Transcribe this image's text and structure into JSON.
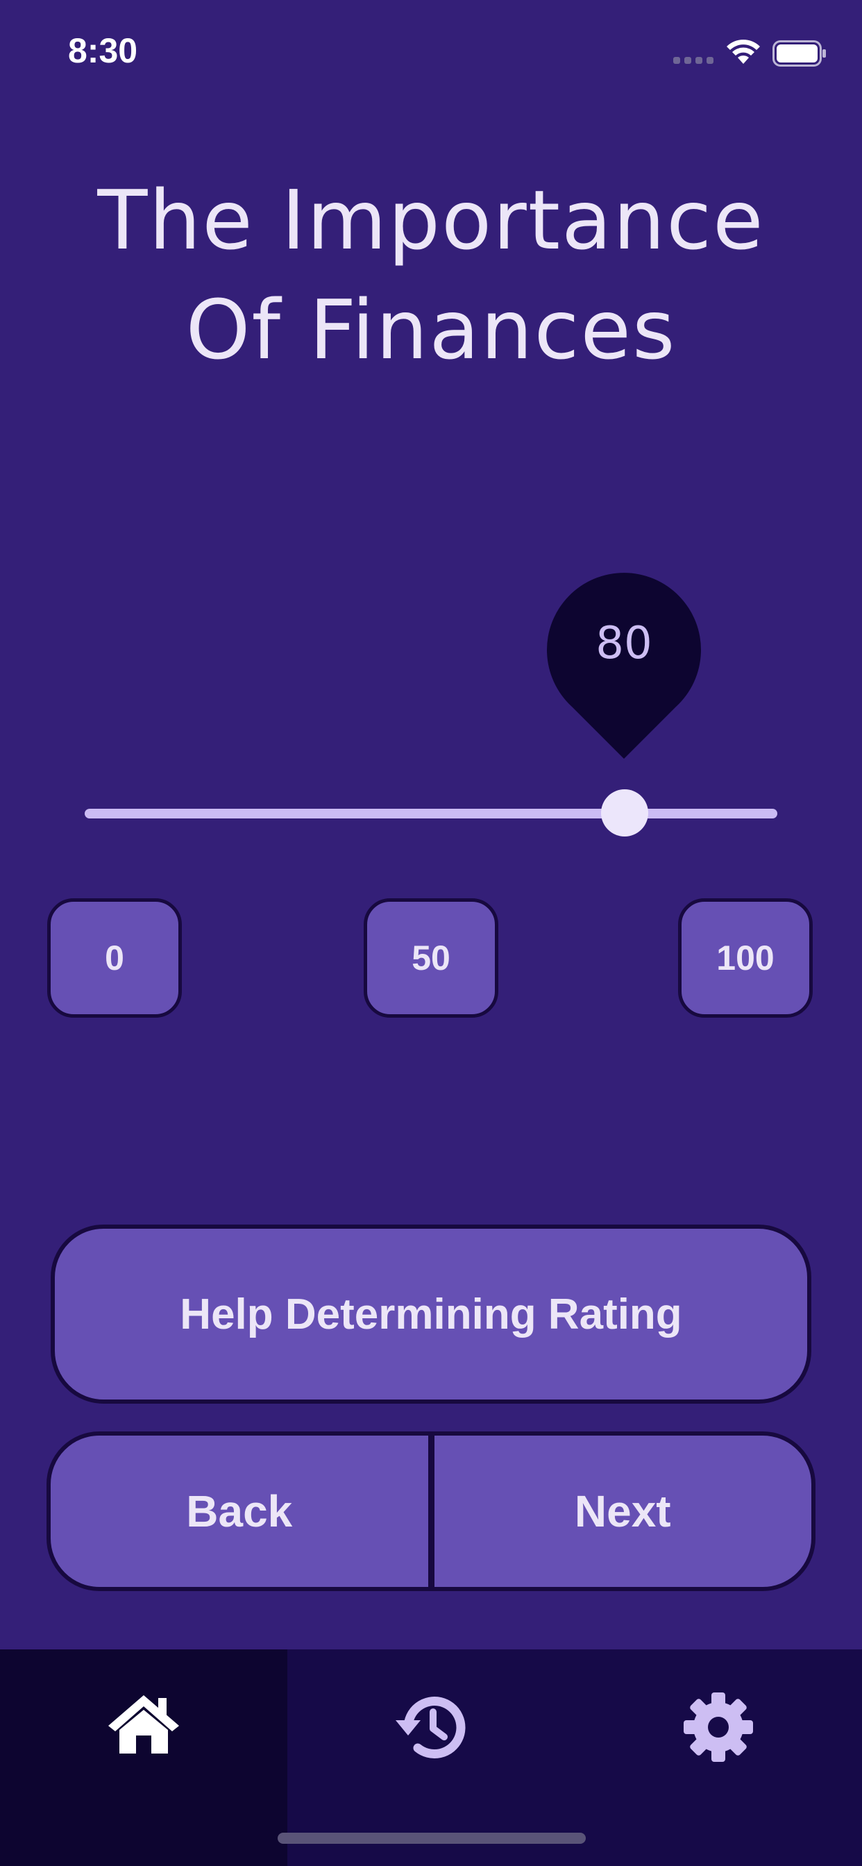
{
  "status_bar": {
    "time": "8:30",
    "icons": [
      "cellular-signal-icon",
      "wifi-icon",
      "battery-icon"
    ]
  },
  "title": {
    "line1": "The Importance",
    "line2": "Of Finances"
  },
  "slider": {
    "value": "80",
    "min": 0,
    "max": 100,
    "level": 80,
    "track_color": "#cbbcf4",
    "bubble_color": "#0d0530"
  },
  "presets": {
    "zero": "0",
    "fifty": "50",
    "hundred": "100"
  },
  "help_button": {
    "label": "Help Determining Rating"
  },
  "navigation": {
    "back": "Back",
    "next": "Next"
  },
  "tab_bar": {
    "tabs": [
      {
        "icon": "home-icon",
        "active": true
      },
      {
        "icon": "history-icon",
        "active": false
      },
      {
        "icon": "gear-icon",
        "active": false
      }
    ]
  },
  "colors": {
    "background": "#341f78",
    "button": "#6650b4",
    "border": "#17093f",
    "text": "#ece6f7",
    "tab_bar": "#160a48"
  }
}
